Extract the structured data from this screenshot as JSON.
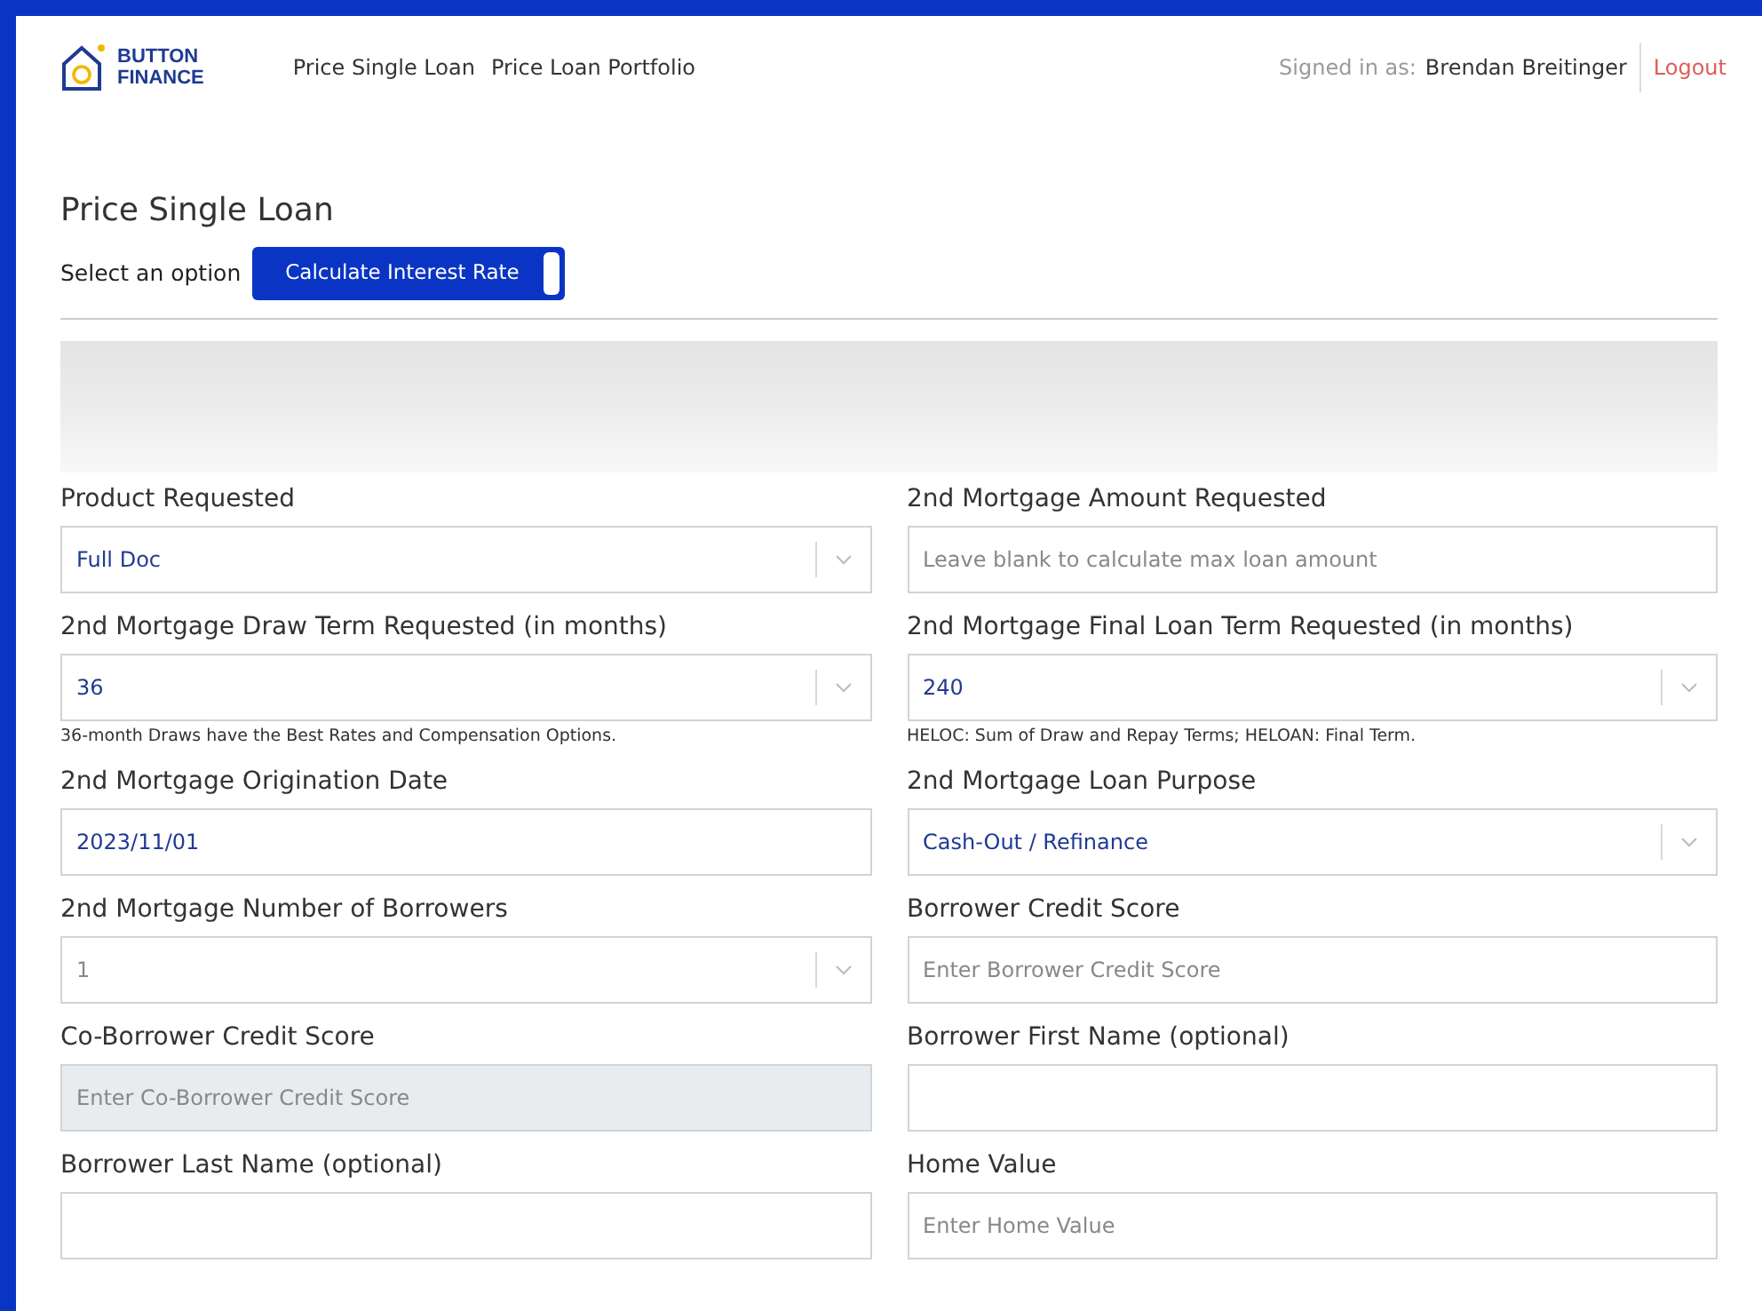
{
  "brand": {
    "line1": "BUTTON",
    "line2": "FINANCE"
  },
  "nav": [
    {
      "label": "Price Single Loan"
    },
    {
      "label": "Price Loan Portfolio"
    }
  ],
  "user": {
    "prefix": "Signed in as:",
    "name": "Brendan Breitinger",
    "logout": "Logout"
  },
  "page_title": "Price Single Loan",
  "option": {
    "label": "Select an option",
    "toggle_label": "Calculate Interest Rate",
    "on": true
  },
  "fields": [
    {
      "label": "Product Requested",
      "kind": "select",
      "value": "Full Doc"
    },
    {
      "label": "2nd Mortgage Amount Requested",
      "kind": "text",
      "placeholder": "Leave blank to calculate max loan amount"
    },
    {
      "label": "2nd Mortgage Draw Term Requested (in months)",
      "kind": "select",
      "value": "36",
      "help": "36-month Draws have the Best Rates and Compensation Options."
    },
    {
      "label": "2nd Mortgage Final Loan Term Requested (in months)",
      "kind": "select",
      "value": "240",
      "help": "HELOC: Sum of Draw and Repay Terms; HELOAN: Final Term."
    },
    {
      "label": "2nd Mortgage Origination Date",
      "kind": "text",
      "value": "2023/11/01"
    },
    {
      "label": "2nd Mortgage Loan Purpose",
      "kind": "select",
      "value": "Cash-Out / Refinance"
    },
    {
      "label": "2nd Mortgage Number of Borrowers",
      "kind": "select",
      "placeholder": "1"
    },
    {
      "label": "Borrower Credit Score",
      "kind": "text",
      "placeholder": "Enter Borrower Credit Score"
    },
    {
      "label": "Co-Borrower Credit Score",
      "kind": "text",
      "placeholder": "Enter Co-Borrower Credit Score",
      "disabled": true
    },
    {
      "label": "Borrower First Name (optional)",
      "kind": "text"
    },
    {
      "label": "Borrower Last Name (optional)",
      "kind": "text"
    },
    {
      "label": "Home Value",
      "kind": "text",
      "placeholder": "Enter Home Value"
    }
  ]
}
